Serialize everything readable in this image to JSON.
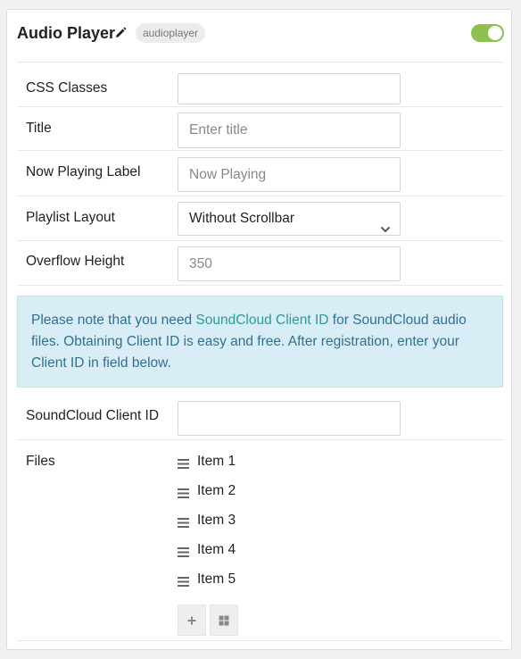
{
  "header": {
    "title": "Audio Player",
    "badge": "audioplayer",
    "enabled": true
  },
  "fields": {
    "css_classes": {
      "label": "CSS Classes",
      "value": ""
    },
    "title": {
      "label": "Title",
      "value": "",
      "placeholder": "Enter title"
    },
    "now_playing": {
      "label": "Now Playing Label",
      "value": "",
      "placeholder": "Now Playing"
    },
    "playlist_layout": {
      "label": "Playlist Layout",
      "selected": "Without Scrollbar"
    },
    "overflow_height": {
      "label": "Overflow Height",
      "value": "",
      "placeholder": "350"
    }
  },
  "notice": {
    "before": "Please note that you need ",
    "link": "SoundCloud Client ID",
    "after": " for SoundCloud audio files. Obtaining Client ID is easy and free. After registration, enter your Client ID in field below."
  },
  "soundcloud": {
    "label": "SoundCloud Client ID",
    "value": ""
  },
  "files": {
    "label": "Files",
    "items": [
      "Item 1",
      "Item 2",
      "Item 3",
      "Item 4",
      "Item 5"
    ]
  },
  "colors": {
    "toggle_on": "#8cc152",
    "notice_bg": "#d9edf7",
    "notice_text": "#31708f",
    "notice_link": "#2a9d8f"
  },
  "icons": {
    "edit": "pencil-icon",
    "layout_select": "chevron-down-icon",
    "drag": "drag-handle-icon",
    "add": "plus-icon",
    "grid": "grid-icon"
  }
}
